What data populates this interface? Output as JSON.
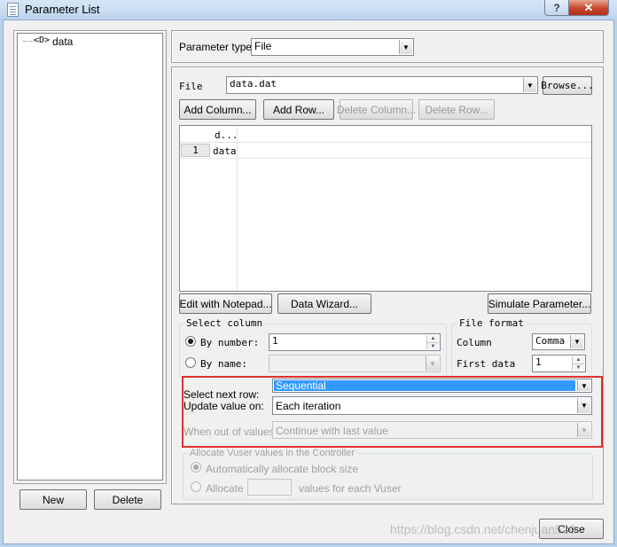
{
  "window": {
    "title": "Parameter List",
    "help_label": "?",
    "close_label": "✕"
  },
  "tree": {
    "items": [
      {
        "label": "data",
        "icon": "parameter-icon",
        "icon_text": "<D>"
      }
    ]
  },
  "left_buttons": {
    "new_label": "New",
    "delete_label": "Delete"
  },
  "param_type": {
    "label": "Parameter type:",
    "value": "File"
  },
  "file": {
    "label": "File",
    "value": "data.dat",
    "browse_label": "Browse..."
  },
  "column_buttons": {
    "add_column": "Add Column...",
    "add_row": "Add Row...",
    "delete_column": "Delete Column...",
    "delete_row": "Delete Row..."
  },
  "grid": {
    "headers": [
      "d..."
    ],
    "rows": [
      {
        "num": "1",
        "cells": [
          "data"
        ]
      }
    ]
  },
  "grid_buttons": {
    "edit_notepad": "Edit with Notepad...",
    "data_wizard": "Data Wizard...",
    "simulate": "Simulate Parameter..."
  },
  "select_column": {
    "title": "Select column",
    "by_number_label": "By number:",
    "by_number_value": "1",
    "by_name_label": "By name:",
    "by_name_value": "",
    "selected": "by_number"
  },
  "file_format": {
    "title": "File format",
    "column_label": "Column",
    "column_value": "Comma",
    "first_data_label": "First data",
    "first_data_value": "1"
  },
  "next_row": {
    "select_label": "Select next row:",
    "select_value": "Sequential",
    "update_label": "Update value on:",
    "update_value": "Each iteration",
    "out_label": "When out of values:",
    "out_value": "Continue with last value"
  },
  "allocate": {
    "title": "Allocate Vuser values in the Controller",
    "auto_label": "Automatically allocate block size",
    "allocate_label": "Allocate",
    "allocate_value": "",
    "suffix_label": "values for each Vuser"
  },
  "footer": {
    "close_label": "Close"
  },
  "watermark": "https://blog.csdn.net/chenjuan520",
  "colors": {
    "highlight_border": "#e0302f",
    "selection": "#3399ff",
    "title_bar": "#bcd3ec"
  }
}
